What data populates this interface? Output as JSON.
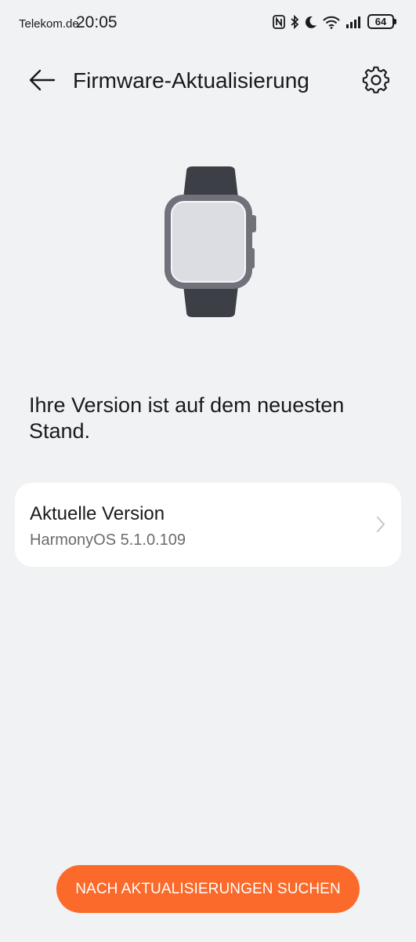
{
  "status_bar": {
    "carrier": "Telekom.de",
    "time": "20:05",
    "battery": "64",
    "icons": [
      "nfc-icon",
      "bluetooth-icon",
      "moon-icon",
      "wifi-icon",
      "signal-icon",
      "battery-icon"
    ]
  },
  "header": {
    "title": "Firmware-Aktualisierung",
    "back_icon": "arrow-left-icon",
    "settings_icon": "gear-icon"
  },
  "illustration": {
    "icon": "smartwatch-icon",
    "colors": {
      "band": "#3c3f45",
      "case": "#70727b",
      "screen": "#dcdde2"
    }
  },
  "status_message": "Ihre Version ist auf dem neuesten Stand.",
  "version_card": {
    "label": "Aktuelle Version",
    "value": "HarmonyOS 5.1.0.109"
  },
  "action_button": {
    "label": "NACH AKTUALISIERUNGEN SUCHEN",
    "color": "#fb6a2b"
  }
}
